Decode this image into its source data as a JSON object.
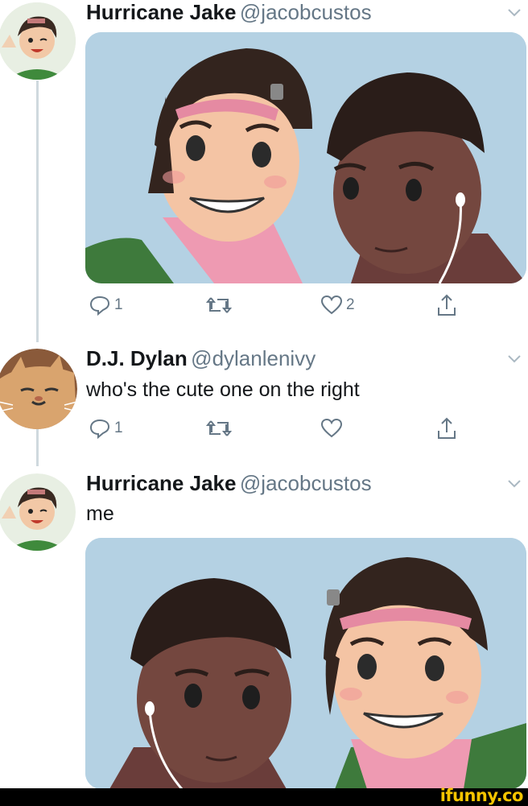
{
  "tweets": [
    {
      "name": "Hurricane Jake",
      "handle": "@jacobcustos",
      "text": "",
      "actions": {
        "reply_count": "1",
        "retweet_count": "",
        "like_count": "2"
      }
    },
    {
      "name": "D.J. Dylan",
      "handle": "@dylanlenivy",
      "text": "who's the cute one on the right",
      "actions": {
        "reply_count": "1",
        "retweet_count": "",
        "like_count": ""
      }
    },
    {
      "name": "Hurricane Jake",
      "handle": "@jacobcustos",
      "text": "me",
      "actions": null
    }
  ],
  "footer": {
    "brand": "ifunny.co"
  },
  "colors": {
    "accent": "#f5c400",
    "muted": "#657786",
    "media_bg": "#b4d1e3",
    "thread_line": "#cfd9de"
  },
  "icons": [
    "reply-icon",
    "retweet-icon",
    "like-icon",
    "share-icon",
    "chevron-down-icon"
  ]
}
